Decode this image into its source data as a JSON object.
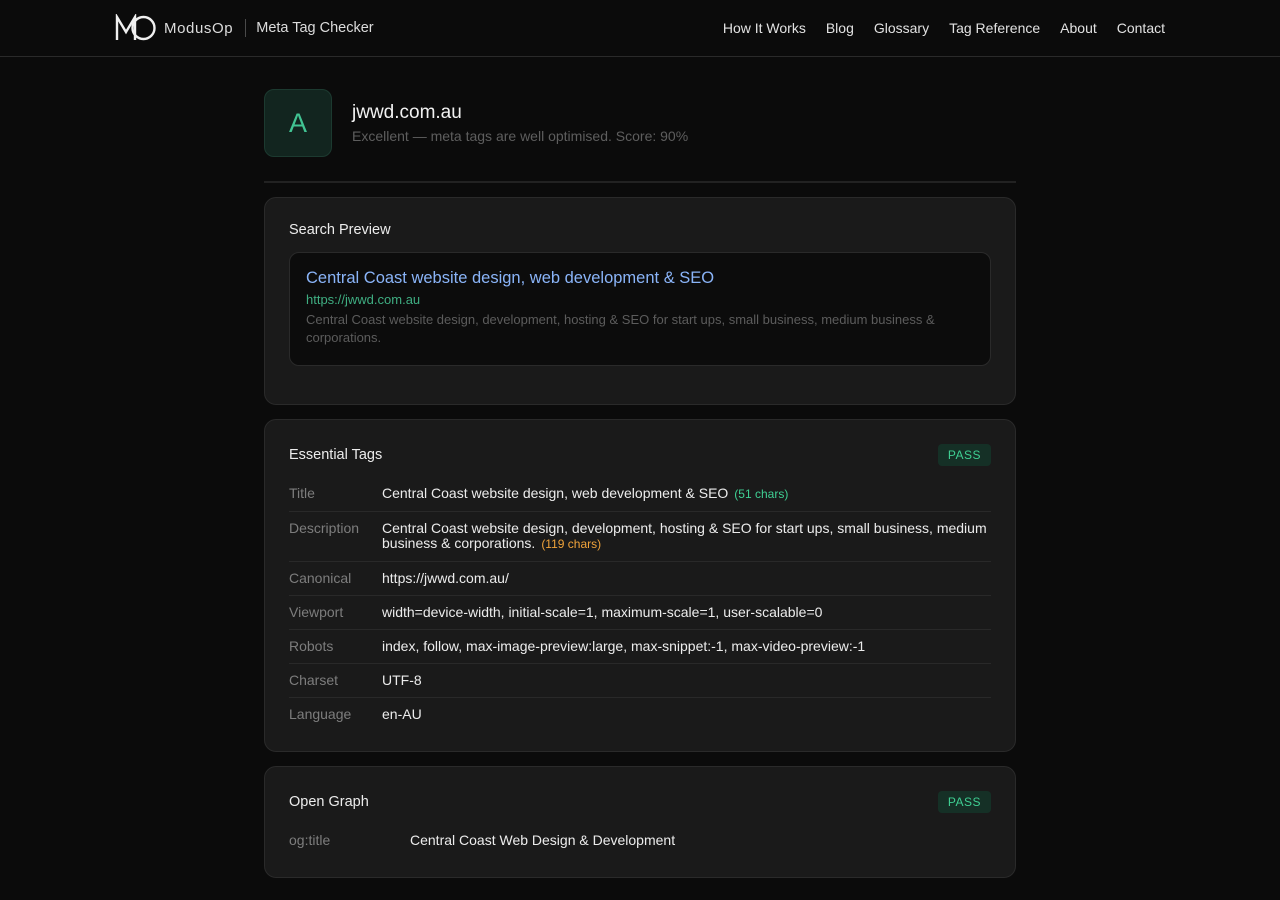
{
  "header": {
    "brand_name": "ModusOp",
    "product_name": "Meta Tag Checker",
    "logo_icon": "modusop-logo",
    "nav": [
      {
        "label": "How It Works"
      },
      {
        "label": "Blog"
      },
      {
        "label": "Glossary"
      },
      {
        "label": "Tag Reference"
      },
      {
        "label": "About"
      },
      {
        "label": "Contact"
      }
    ]
  },
  "site": {
    "grade": "A",
    "domain": "jwwd.com.au",
    "summary": "Excellent — meta tags are well optimised. Score: 90%"
  },
  "search_preview": {
    "heading": "Search Preview",
    "title": "Central Coast website design, web development & SEO",
    "url": "https://jwwd.com.au",
    "description": "Central Coast website design, development, hosting & SEO for start ups, small business, medium business & corporations."
  },
  "essential_tags": {
    "heading": "Essential Tags",
    "status": "PASS",
    "rows": [
      {
        "label": "Title",
        "value": "Central Coast website design, web development & SEO",
        "note": "(51 chars)"
      },
      {
        "label": "Description",
        "value": "Central Coast website design, development, hosting & SEO for start ups, small business, medium business & corporations.",
        "note": "(119 chars)"
      },
      {
        "label": "Canonical",
        "value": "https://jwwd.com.au/"
      },
      {
        "label": "Viewport",
        "value": "width=device-width, initial-scale=1, maximum-scale=1, user-scalable=0"
      },
      {
        "label": "Robots",
        "value": "index, follow, max-image-preview:large, max-snippet:-1, max-video-preview:-1"
      },
      {
        "label": "Charset",
        "value": "UTF-8"
      },
      {
        "label": "Language",
        "value": "en-AU"
      }
    ]
  },
  "open_graph": {
    "heading": "Open Graph",
    "status": "PASS",
    "rows": [
      {
        "label": "og:title",
        "value": "Central Coast Web Design & Development"
      }
    ]
  },
  "colors": {
    "background": "#0b0b0b",
    "card": "#1a1a1a",
    "accent_green": "#3fcf93",
    "link_blue": "#8ab4f8",
    "warn_orange": "#f0a33a"
  }
}
